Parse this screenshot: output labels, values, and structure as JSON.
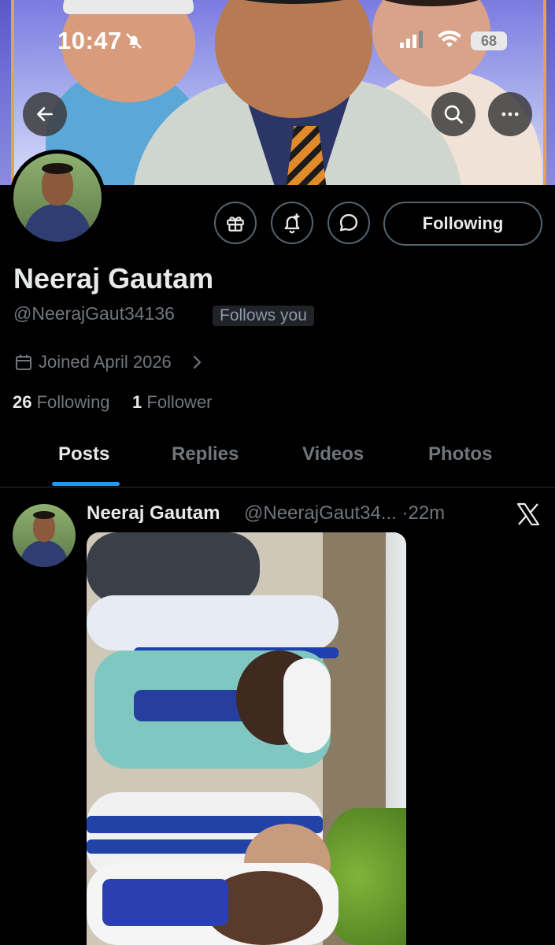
{
  "status_bar": {
    "time": "10:47",
    "battery": "68"
  },
  "profile": {
    "display_name": "Neeraj Gautam",
    "handle": "@NeerajGaut34136",
    "follows_you_badge": "Follows you",
    "joined": "Joined April 2026",
    "following_count": "26",
    "following_label": "Following",
    "followers_count": "1",
    "followers_label": "Follower",
    "follow_button_label": "Following"
  },
  "tabs": [
    {
      "label": "Posts",
      "active": true
    },
    {
      "label": "Replies",
      "active": false
    },
    {
      "label": "Videos",
      "active": false
    },
    {
      "label": "Photos",
      "active": false
    }
  ],
  "post": {
    "author_name": "Neeraj Gautam",
    "author_handle": "@NeerajGaut34...",
    "time": "22m",
    "separator": "·"
  },
  "colors": {
    "accent": "#1d9bf0",
    "background": "#000000",
    "muted_text": "#71767b",
    "primary_text": "#e7e9ea",
    "border": "#536471"
  },
  "icons": {
    "back": "arrow-left-icon",
    "search": "search-icon",
    "more": "more-horizontal-icon",
    "gift": "gift-icon",
    "notify": "bell-plus-icon",
    "message": "chat-bubble-icon",
    "calendar": "calendar-icon",
    "x_logo": "x-logo-icon"
  }
}
